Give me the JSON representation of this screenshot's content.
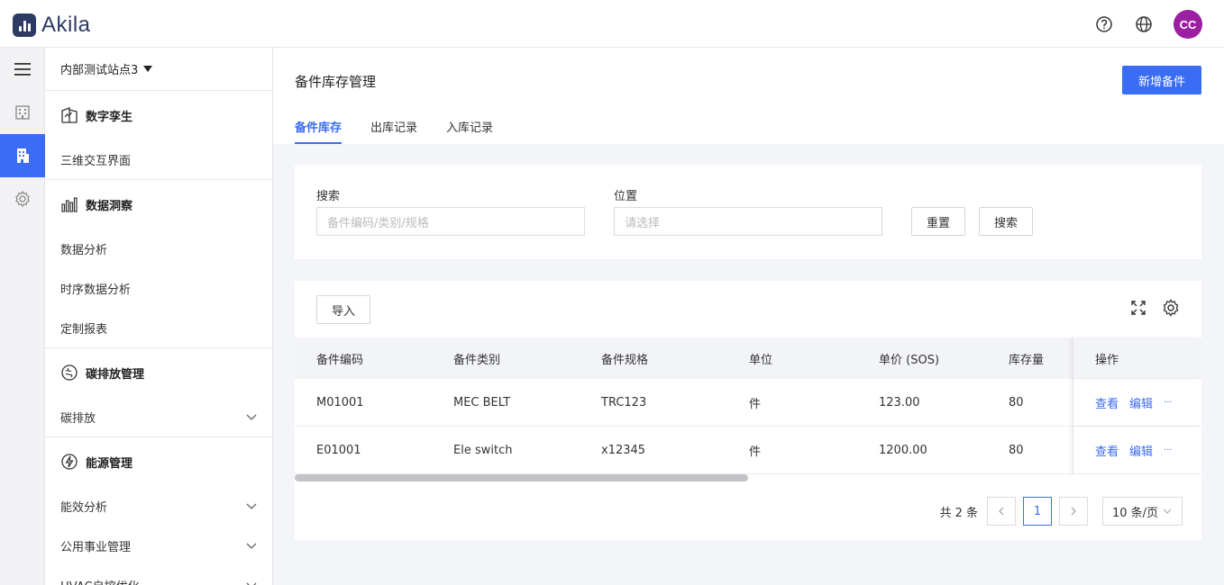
{
  "header": {
    "logo_text": "Akila",
    "avatar_initials": "CC"
  },
  "sidebar": {
    "site_name": "内部测试站点3",
    "groups": [
      {
        "title": "数字孪生",
        "icon": "digital-twin-icon",
        "items": [
          {
            "label": "三维交互界面",
            "expandable": false
          }
        ]
      },
      {
        "title": "数据洞察",
        "icon": "bar-chart-icon",
        "items": [
          {
            "label": "数据分析",
            "expandable": false
          },
          {
            "label": "时序数据分析",
            "expandable": false
          },
          {
            "label": "定制报表",
            "expandable": false
          }
        ]
      },
      {
        "title": "碳排放管理",
        "icon": "carbon-icon",
        "items": [
          {
            "label": "碳排放",
            "expandable": true
          }
        ]
      },
      {
        "title": "能源管理",
        "icon": "lightning-icon",
        "items": [
          {
            "label": "能效分析",
            "expandable": true
          },
          {
            "label": "公用事业管理",
            "expandable": true
          },
          {
            "label": "HVAC自控优化",
            "expandable": true
          }
        ]
      }
    ]
  },
  "page": {
    "title": "备件库存管理",
    "add_button": "新增备件",
    "tabs": [
      "备件库存",
      "出库记录",
      "入库记录"
    ],
    "active_tab": 0
  },
  "filter": {
    "search_label": "搜索",
    "search_placeholder": "备件编码/类别/规格",
    "location_label": "位置",
    "location_placeholder": "请选择",
    "reset_button": "重置",
    "search_button": "搜索"
  },
  "table": {
    "import_button": "导入",
    "columns": [
      "备件编码",
      "备件类别",
      "备件规格",
      "单位",
      "单价 (SOS)",
      "库存量",
      "操作"
    ],
    "rows": [
      [
        "M01001",
        "MEC BELT",
        "TRC123",
        "件",
        "123.00",
        "80"
      ],
      [
        "E01001",
        "Ele switch",
        "x12345",
        "件",
        "1200.00",
        "80"
      ]
    ],
    "actions": {
      "view": "查看",
      "edit": "编辑",
      "more": "···"
    }
  },
  "pagination": {
    "total_text": "共 2 条",
    "current_page": "1",
    "page_size": "10 条/页"
  },
  "colors": {
    "accent": "#3a6cf4",
    "avatar": "#9b1fa0",
    "brand": "#2d3a63"
  }
}
